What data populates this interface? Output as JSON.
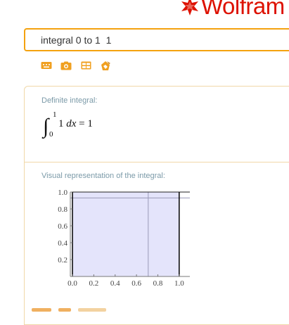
{
  "brand": {
    "name": "Wolfram",
    "color": "#dd1100"
  },
  "search": {
    "value": "integral 0 to 1  1",
    "accent": "#f4a20f"
  },
  "input_tools": [
    {
      "icon": "keyboard-icon"
    },
    {
      "icon": "camera-icon"
    },
    {
      "icon": "table-icon"
    },
    {
      "icon": "examples-icon"
    }
  ],
  "pods": {
    "definite": {
      "title": "Definite integral:",
      "upper": "1",
      "lower": "0",
      "integrand": "1",
      "differential": "d",
      "variable": "x",
      "equals": "= 1"
    },
    "visual": {
      "title": "Visual representation of the integral:"
    }
  },
  "chart_data": {
    "type": "area",
    "x": [
      0,
      1
    ],
    "y": [
      1,
      1
    ],
    "xlim": [
      -0.02,
      1.1
    ],
    "ylim": [
      0,
      1.0
    ],
    "xticks": [
      "0.0",
      "0.2",
      "0.4",
      "0.6",
      "0.8",
      "1.0"
    ],
    "yticks": [
      "0.2",
      "0.4",
      "0.6",
      "0.8",
      "1.0"
    ],
    "fill_color": "#e4e4fb",
    "bound_color": "#000000",
    "guide_lines": {
      "vertical_x": 0.71,
      "horizontal_y": 0.93
    }
  }
}
